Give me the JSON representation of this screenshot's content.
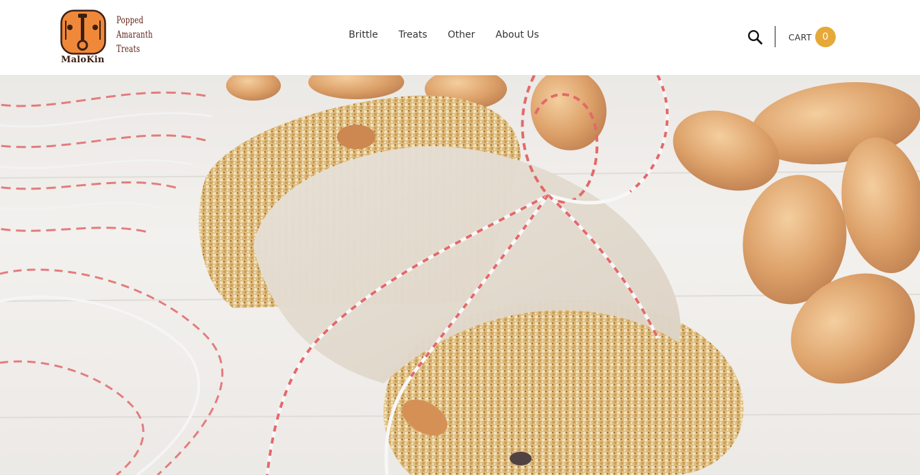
{
  "brand": {
    "name": "MaloKin",
    "tagline": [
      "Popped",
      "Amaranth",
      "Treats"
    ],
    "logo_color": "#f0883a"
  },
  "nav": {
    "items": [
      {
        "label": "Brittle"
      },
      {
        "label": "Treats"
      },
      {
        "label": "Other"
      },
      {
        "label": "About Us"
      }
    ]
  },
  "header_actions": {
    "search_icon": "search-icon",
    "cart_label": "CART",
    "cart_count": "0",
    "cart_badge_color": "#e6a838"
  },
  "hero": {
    "image": "amaranth-bar-with-twine-and-almonds"
  }
}
